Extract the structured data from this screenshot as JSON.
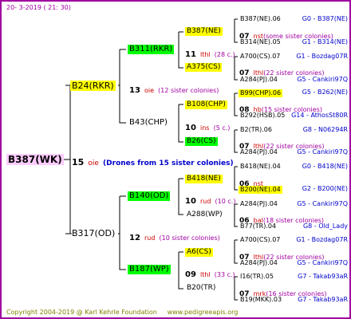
{
  "header": {
    "date": "20-  3-2019 ( 21: 30)"
  },
  "footer": {
    "copyright": "Copyright 2004-2019 @ Karl Kehrle Foundation",
    "site": "www.pedigreeapis.org"
  },
  "colors": {
    "frame": "#a000a0",
    "yellow": "#ffff00",
    "green": "#00ff00",
    "pink": "#ffccff",
    "blue_text": "#0000cc",
    "red_text": "#cc0000",
    "purple_text": "#a000a0"
  },
  "root": {
    "label": "B387(WK)",
    "count": "15",
    "prod": "oie",
    "note": "(Drones from 15 sister colonies)"
  },
  "g1": [
    {
      "label": "B24(RKR)",
      "count": "13",
      "prod": "oie",
      "note": "(12 sister colonies)"
    },
    {
      "label": "B317(OD)",
      "count": "12",
      "prod": "rud",
      "note": "(10 sister colonies)"
    }
  ],
  "g2": [
    {
      "label": "B311(RKR)",
      "count": "11",
      "prod": "lthl",
      "note": "(28 c.)"
    },
    {
      "label": "B43(CHP)",
      "count": "10",
      "prod": "ins",
      "note": "(5 c.)"
    },
    {
      "label": "B140(OD)",
      "count": "10",
      "prod": "rud",
      "note": "(10 c.)"
    },
    {
      "label": "B187(WP)",
      "count": "09",
      "prod": "lthl",
      "note": "(33 c.)"
    }
  ],
  "g3": [
    {
      "label": "B387(NE)",
      "count": "07",
      "prod": "nst",
      "note": "(some sister colonies)"
    },
    {
      "label": "A375(CS)",
      "count": "07",
      "prod": "lthl",
      "note": "(22 sister colonies)"
    },
    {
      "label": "B108(CHP)",
      "count": "08",
      "prod": "hb",
      "note": "(15 sister colonies)"
    },
    {
      "label": "B26(CS)",
      "count": "07",
      "prod": "lthl",
      "note": "(22 sister colonies)"
    },
    {
      "label": "B418(NE)",
      "count": "06",
      "prod": "nst",
      "note": ""
    },
    {
      "label": "A288(WP)",
      "count": "06",
      "prod": "bal",
      "note": "(18 sister colonies)"
    },
    {
      "label": "A6(CS)",
      "count": "07",
      "prod": "lthl",
      "note": "(22 sister colonies)"
    },
    {
      "label": "B20(TR)",
      "count": "07",
      "prod": "mrk",
      "note": "(16 sister colonies)"
    }
  ],
  "g4": [
    {
      "name": "B387(NE).06",
      "code": "G0 - B387(NE)"
    },
    {
      "name": "B314(NE).05",
      "code": "G1 - B314(NE)"
    },
    {
      "name": "A700(CS).07",
      "code": "G1 - Bozdag07R"
    },
    {
      "name": "A284(PJ).04",
      "code": "G5 - Cankiri97Q"
    },
    {
      "name": "B99(CHP).06",
      "code": "G5 - B262(NE)"
    },
    {
      "name": "B292(HSB).05",
      "code": "G14 - AthosSt80R"
    },
    {
      "name": "B2(TR).06",
      "code": "G8 - N06294R"
    },
    {
      "name": "A284(PJ).04",
      "code": "G5 - Cankiri97Q"
    },
    {
      "name": "B418(NE).04",
      "code": "G0 - B418(NE)"
    },
    {
      "name": "B200(NE).04",
      "code": "G2 - B200(NE)"
    },
    {
      "name": "A284(PJ).04",
      "code": "G5 - Cankiri97Q"
    },
    {
      "name": "B77(TR).04",
      "code": "G8 - Old_Lady"
    },
    {
      "name": "A700(CS).07",
      "code": "G1 - Bozdag07R"
    },
    {
      "name": "A284(PJ).04",
      "code": "G5 - Cankiri97Q"
    },
    {
      "name": "I16(TR).05",
      "code": "G7 - Takab93aR"
    },
    {
      "name": "B19(MKK).03",
      "code": "G7 - Takab93aR"
    }
  ]
}
